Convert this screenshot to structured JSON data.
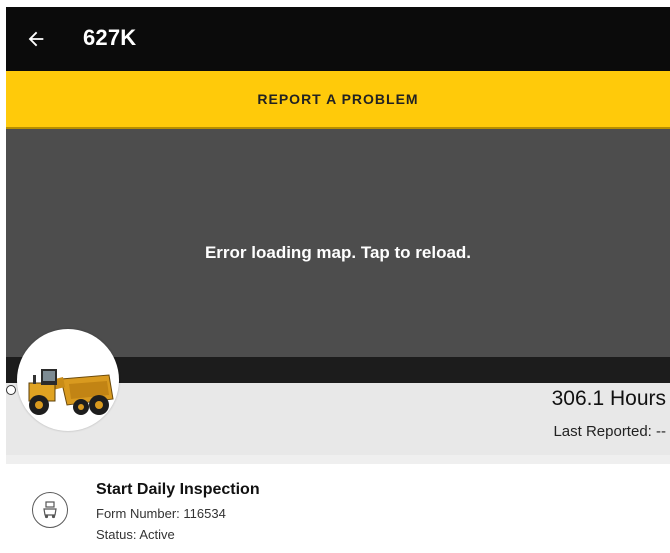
{
  "header": {
    "title": "627K",
    "back_icon": "arrow-left-icon"
  },
  "report_button": {
    "label": "REPORT A PROBLEM",
    "color": "#ffca0a"
  },
  "map": {
    "error_text": "Error loading map. Tap to reload."
  },
  "machine": {
    "hours": "306.1 Hours",
    "last_reported": "Last Reported: --",
    "image_icon": "wheel-tractor-scraper-image"
  },
  "inspection_card": {
    "icon": "inspection-clipboard-icon",
    "title": "Start Daily Inspection",
    "form_number": "Form Number: 116534",
    "status": "Status: Active"
  }
}
